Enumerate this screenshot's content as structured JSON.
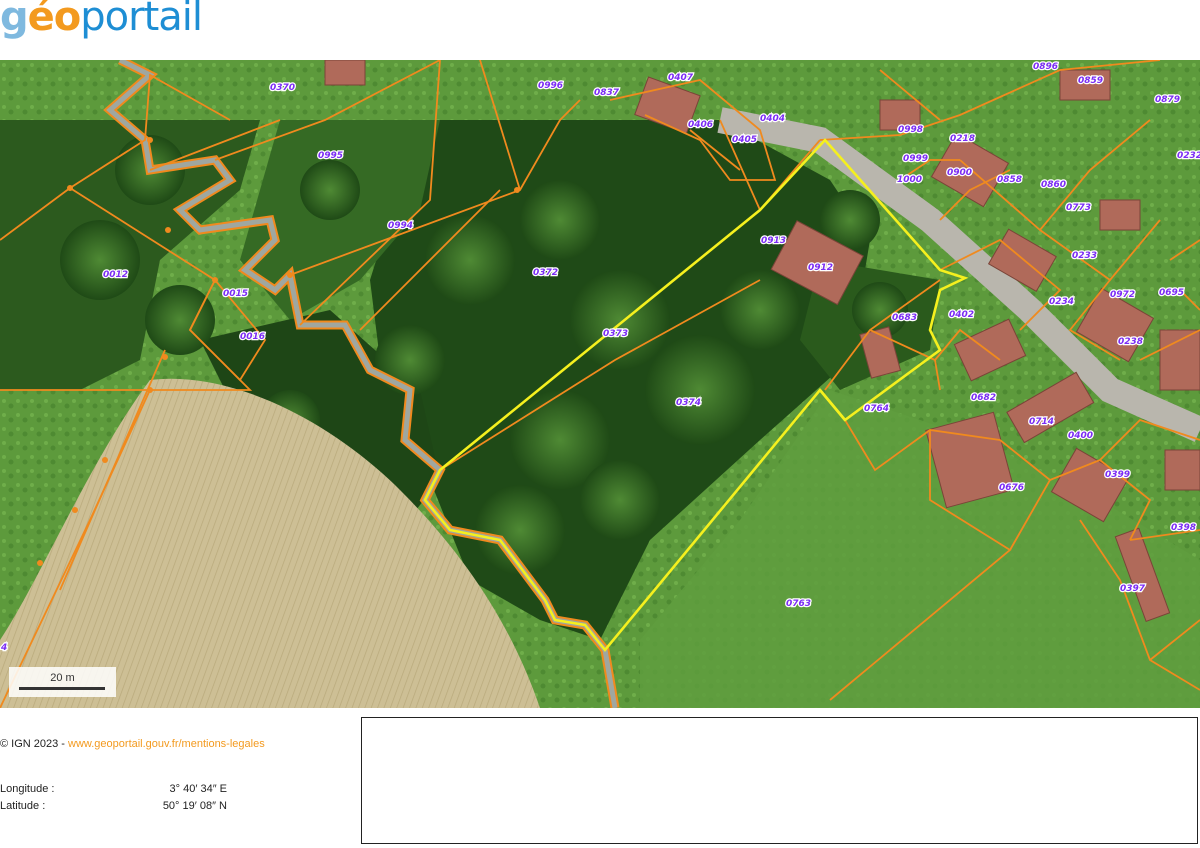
{
  "logo": {
    "g": "g",
    "e": "é",
    "o": "o",
    "rest": "portail"
  },
  "map": {
    "parcel_labels": [
      "0370",
      "0995",
      "0996",
      "0837",
      "0407",
      "0406",
      "0405",
      "0404",
      "0896",
      "0859",
      "0879",
      "0998",
      "0218",
      "0999",
      "0900",
      "1000",
      "0858",
      "0860",
      "0232",
      "0994",
      "0773",
      "0012",
      "0372",
      "0913",
      "0912",
      "0233",
      "0015",
      "0016",
      "0373",
      "0683",
      "0402",
      "0234",
      "0972",
      "0695",
      "0238",
      "0374",
      "0764",
      "0682",
      "0714",
      "0400",
      "0399",
      "0676",
      "0398",
      "0763",
      "0397",
      "4"
    ],
    "scale_label": "20 m",
    "colors": {
      "parcel_border": "#f08a1e",
      "parcel_label": "#7b2cf5",
      "selection": "#f5f01e",
      "building": "#b06a5a"
    }
  },
  "footer": {
    "copyright": "© IGN 2023 - ",
    "link": "www.geoportail.gouv.fr/mentions-legales",
    "longitude_label": "Longitude :",
    "longitude_value": "3° 40′ 34″ E",
    "latitude_label": "Latitude :",
    "latitude_value": "50° 19′ 08″ N"
  }
}
